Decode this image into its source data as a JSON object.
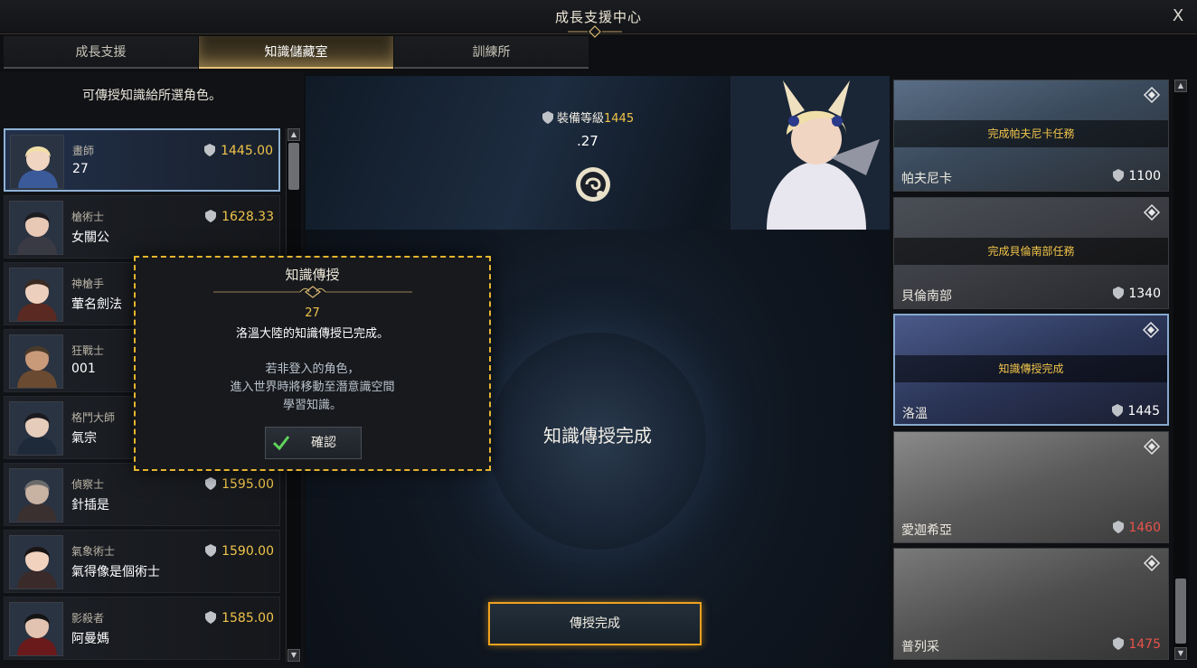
{
  "window": {
    "title": "成長支援中心",
    "close_label": "X"
  },
  "tabs": [
    {
      "label": "成長支援"
    },
    {
      "label": "知識儲藏室"
    },
    {
      "label": "訓練所"
    }
  ],
  "left": {
    "header": "可傳授知識給所選角色。",
    "characters": [
      {
        "class": "畫師",
        "name": "27",
        "level": "1445.00"
      },
      {
        "class": "槍術士",
        "name": "女關公",
        "level": "1628.33"
      },
      {
        "class": "神槍手",
        "name": "葷名劍法",
        "level": ""
      },
      {
        "class": "狂戰士",
        "name": "001",
        "level": ""
      },
      {
        "class": "格鬥大師",
        "name": "氣宗",
        "level": ""
      },
      {
        "class": "偵察士",
        "name": "針插是",
        "level": "1595.00"
      },
      {
        "class": "氣象術士",
        "name": "氣得像是個術士",
        "level": "1590.00"
      },
      {
        "class": "影殺者",
        "name": "阿曼媽",
        "level": "1585.00"
      }
    ]
  },
  "center": {
    "gear_label": "裝備等級",
    "gear_value": "1445",
    "char_name": ".27",
    "status_text": "知識傳授完成",
    "complete_button": "傳授完成"
  },
  "regions": [
    {
      "state": "完成帕夫尼卡任務",
      "name": "帕夫尼卡",
      "level": "1100",
      "level_color": "white"
    },
    {
      "state": "完成貝倫南部任務",
      "name": "貝倫南部",
      "level": "1340",
      "level_color": "white"
    },
    {
      "state": "知識傳授完成",
      "name": "洛溫",
      "level": "1445",
      "level_color": "white"
    },
    {
      "state": "",
      "name": "愛迦希亞",
      "level": "1460",
      "level_color": "red"
    },
    {
      "state": "",
      "name": "普列采",
      "level": "1475",
      "level_color": "red"
    }
  ],
  "dialog": {
    "title": "知識傳授",
    "number": "27",
    "message": "洛溫大陸的知識傳授已完成。",
    "note_line1": "若非登入的角色，",
    "note_line2": "進入世界時將移動至潛意識空間",
    "note_line3": "學習知識。",
    "confirm_label": "確認"
  },
  "colors": {
    "gold": "#f0c44a",
    "red": "#e8534a",
    "highlight": "#f0a21e",
    "selected": "#8fb2d6"
  }
}
